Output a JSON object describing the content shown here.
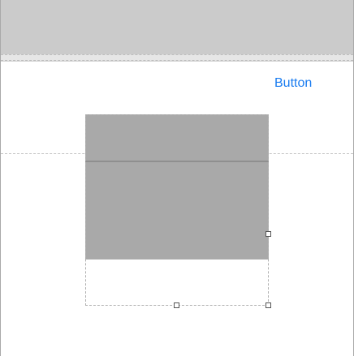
{
  "header": {
    "button_label": "Button"
  },
  "colors": {
    "button_text": "#1a7cf0",
    "top_bar": "#cbcbcb",
    "block_fill": "#a9a9a9",
    "background": "#ffffff"
  },
  "icons": [
    "resize-handle-icon"
  ]
}
